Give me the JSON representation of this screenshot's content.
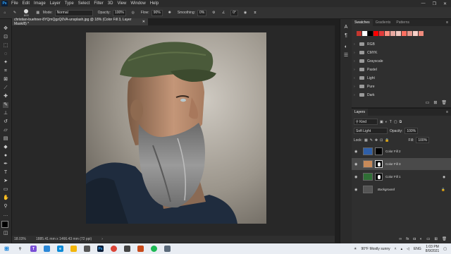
{
  "menubar": {
    "app_logo": "Ps",
    "items": [
      "File",
      "Edit",
      "Image",
      "Layer",
      "Type",
      "Select",
      "Filter",
      "3D",
      "View",
      "Window",
      "Help"
    ]
  },
  "options": {
    "brush_size": "600",
    "mode_label": "Mode:",
    "mode_value": "Normal",
    "opacity_label": "Opacity:",
    "opacity_value": "100%",
    "flow_label": "Flow:",
    "flow_value": "90%",
    "smoothing_label": "Smoothing:",
    "smoothing_value": "0%",
    "angle_value": "0°"
  },
  "document": {
    "tab_title": "christian-buehner-8YQmQgzQ0VA-unsplash.jpg @ 18% (Color Fill 3, Layer Mask/8) *",
    "zoom": "18.03%",
    "doc_info": "1885.41 mm x 1466.43 mm (72 ppi)"
  },
  "swatches_panel": {
    "tabs": [
      "Swatches",
      "Gradients",
      "Patterns"
    ],
    "colors": [
      "#c4372f",
      "#ffffff",
      "#000000",
      "#ff0000",
      "#e23a3a",
      "#ff8f80",
      "#e8a8a0",
      "#f0c8c0",
      "#ff6f60",
      "#e59a8f",
      "#f7d0c8",
      "#ef8a7c"
    ],
    "folders": [
      "RGB",
      "CMYK",
      "Grayscale",
      "Pastel",
      "Light",
      "Pure",
      "Dark"
    ]
  },
  "layers_panel": {
    "tabs": [
      "Layers"
    ],
    "kind_label": "Kind",
    "blend_mode": "Soft Light",
    "opacity_label": "Opacity:",
    "opacity_value": "100%",
    "lock_label": "Lock:",
    "fill_label": "Fill:",
    "fill_value": "100%",
    "layers": [
      {
        "name": "Color Fill 2",
        "color": "#2f5fa8",
        "selected": false
      },
      {
        "name": "Color Fill 3",
        "color": "#c78a5a",
        "selected": true
      },
      {
        "name": "Color Fill 1",
        "color": "#2f6e35",
        "selected": false
      },
      {
        "name": "Background",
        "color": "#555555",
        "selected": false
      }
    ]
  },
  "taskbar": {
    "weather": "90°F  Mostly sunny",
    "lang": "ENG",
    "time": "1:03 PM",
    "date": "8/9/2021"
  }
}
